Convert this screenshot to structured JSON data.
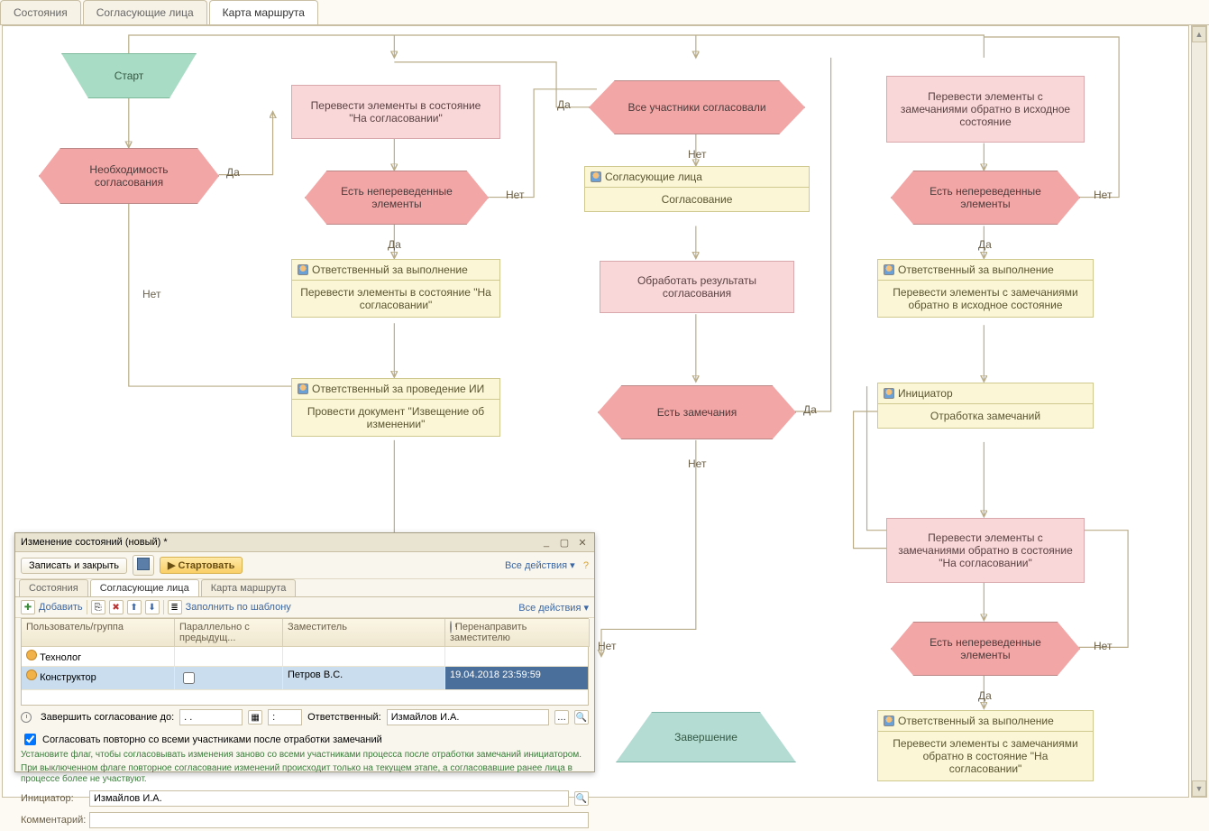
{
  "tabs": {
    "t0": "Состояния",
    "t1": "Согласующие лица",
    "t2": "Карта маршрута",
    "active": 2
  },
  "labels": {
    "yes": "Да",
    "no": "Нет"
  },
  "start": "Старт",
  "end": "Завершение",
  "n_need": "Необходимость согласования",
  "n_moveApprove": "Перевести элементы в состояние \"На согласовании\"",
  "n_hasUntrans": "Есть непереведенные элементы",
  "n_respExec": "Ответственный за выполнение",
  "n_respExec_body": "Перевести элементы в состояние \"На согласовании\"",
  "n_respII": "Ответственный за проведение ИИ",
  "n_respII_body": "Провести документ \"Извещение об изменении\"",
  "n_allApproved": "Все участники согласовали",
  "n_approvers": "Согласующие лица",
  "n_approvers_body": "Согласование",
  "n_process": "Обработать результаты согласования",
  "n_hasRemarks": "Есть замечания",
  "n_moveBack": "Перевести элементы с замечаниями обратно в исходное состояние",
  "n_respExec2_body": "Перевести элементы с замечаниями обратно в исходное состояние",
  "n_initiator": "Инициатор",
  "n_initiator_body": "Отработка замечаний",
  "n_moveBack2": "Перевести элементы с замечаниями обратно в состояние \"На согласовании\"",
  "n_respExec3_body": "Перевести элементы с замечаниями обратно в состояние \"На согласовании\"",
  "dialog": {
    "title": "Изменение состояний (новый) *",
    "save_close": "Записать и закрыть",
    "start_btn": "Стартовать",
    "all_actions": "Все действия",
    "tabs": {
      "t0": "Состояния",
      "t1": "Согласующие лица",
      "t2": "Карта маршрута"
    },
    "add": "Добавить",
    "fill_tpl": "Заполнить по шаблону",
    "cols": {
      "user": "Пользователь/группа",
      "parallel": "Параллельно с предыдущ...",
      "deputy": "Заместитель",
      "redirect": "Перенаправить заместителю"
    },
    "rows": [
      {
        "user": "Технолог",
        "parallel": "",
        "deputy": "",
        "redirect": ""
      },
      {
        "user": "Конструктор",
        "parallel": "",
        "deputy": "Петров В.С.",
        "redirect": "19.04.2018 23:59:59"
      }
    ],
    "complete_before": "Завершить согласование до:",
    "date_empty": "  .  .    ",
    "time_empty": "  :  ",
    "responsible_lbl": "Ответственный:",
    "responsible_val": "Измайлов И.А.",
    "reapprove": "Согласовать повторно со всеми участниками после отработки замечаний",
    "hint1": "Установите флаг, чтобы согласовывать изменения заново со всеми участниками процесса после отработки замечаний инициатором.",
    "hint2": "При выключенном флаге повторное согласование изменений происходит только на текущем этапе, а согласовавшие ранее лица в процессе более не участвуют.",
    "initiator_lbl": "Инициатор:",
    "initiator_val": "Измайлов И.А.",
    "comment_lbl": "Комментарий:"
  }
}
